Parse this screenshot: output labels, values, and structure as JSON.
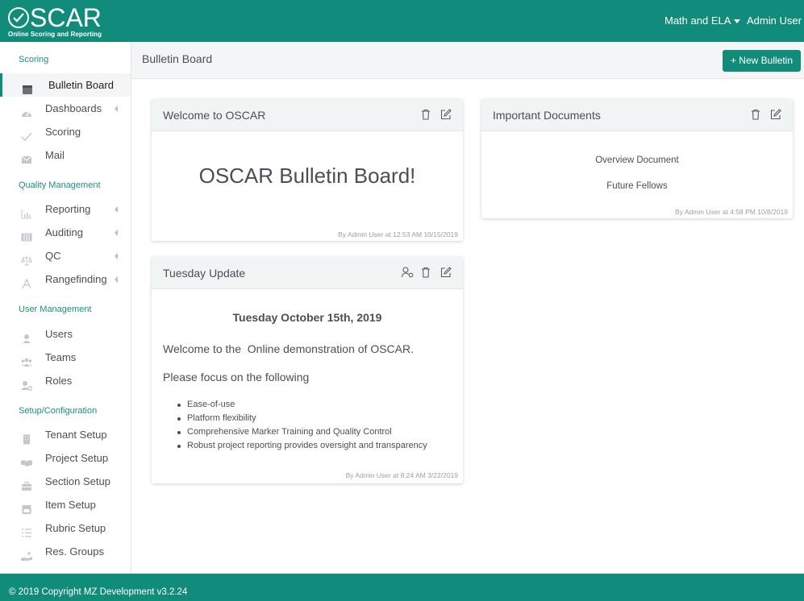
{
  "header": {
    "logo_text": "SCAR",
    "logo_subtitle": "Online Scoring and Reporting",
    "subject_menu": "Math and ELA",
    "user_menu": "Admin User"
  },
  "sidebar": {
    "sections": [
      {
        "label": "Scoring"
      },
      {
        "label": "Quality Management"
      },
      {
        "label": "User Management"
      },
      {
        "label": "Setup/Configuration"
      }
    ],
    "items": [
      {
        "label": "Bulletin Board",
        "icon": "calendar-icon",
        "active": true
      },
      {
        "label": "Dashboards",
        "icon": "tachometer-icon",
        "has_submenu": true
      },
      {
        "label": "Scoring",
        "icon": "check-icon"
      },
      {
        "label": "Mail",
        "icon": "envelope-icon"
      },
      {
        "label": "Reporting",
        "icon": "bar-chart-icon",
        "has_submenu": true
      },
      {
        "label": "Auditing",
        "icon": "columns-icon",
        "has_submenu": true
      },
      {
        "label": "QC",
        "icon": "balance-scale-icon",
        "has_submenu": true
      },
      {
        "label": "Rangefinding",
        "icon": "compass-icon",
        "has_submenu": true
      },
      {
        "label": "Users",
        "icon": "user-icon"
      },
      {
        "label": "Teams",
        "icon": "users-icon"
      },
      {
        "label": "Roles",
        "icon": "user-cog-icon"
      },
      {
        "label": "Tenant Setup",
        "icon": "building-icon"
      },
      {
        "label": "Project Setup",
        "icon": "handshake-icon"
      },
      {
        "label": "Section Setup",
        "icon": "toolbox-icon"
      },
      {
        "label": "Item Setup",
        "icon": "window-icon"
      },
      {
        "label": "Rubric Setup",
        "icon": "list-icon"
      },
      {
        "label": "Res. Groups",
        "icon": "hand-holding-icon"
      }
    ]
  },
  "titlebar": {
    "title": "Bulletin Board",
    "new_button": "+ New Bulletin"
  },
  "cards": {
    "welcome": {
      "title": "Welcome to OSCAR",
      "heading": "OSCAR Bulletin Board!",
      "footer": "By Admin User at 12:53 AM 10/15/2019"
    },
    "documents": {
      "title": "Important Documents",
      "links": [
        "Overview Document",
        "Future Fellows"
      ],
      "footer": "By Admin User at 4:58 PM 10/8/2019"
    },
    "tuesday": {
      "title": "Tuesday Update",
      "date": "Tuesday October 15th, 2019",
      "intro": "Welcome to the  Online demonstration of OSCAR.",
      "focus": "Please focus on the following",
      "bullets": [
        "Ease-of-use",
        "Platform flexibility",
        "Comprehensive Marker Training and Quality Control",
        "Robust project reporting provides oversight and transparency"
      ],
      "footer": "By Admin User at 8:24 AM 3/22/2019"
    }
  },
  "footer": {
    "text": "© 2019 Copyright MZ Development v3.2.24"
  },
  "colors": {
    "brand": "#128c7a",
    "section_label": "#1e8f7e",
    "text": "#4a4f57"
  }
}
